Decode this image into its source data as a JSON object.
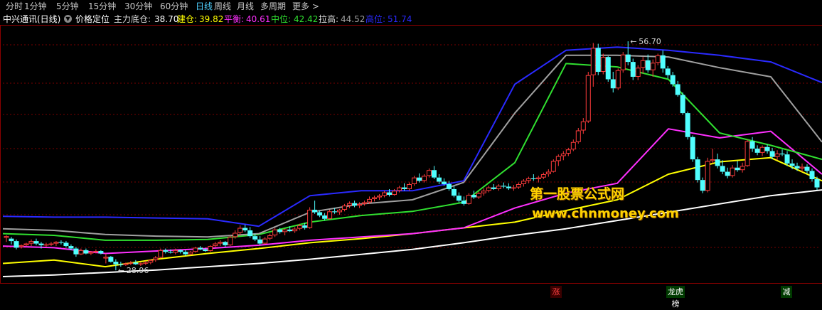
{
  "period_tabs": [
    {
      "label": "分时",
      "active": false
    },
    {
      "label": "1分钟",
      "active": false
    },
    {
      "label": "5分钟",
      "active": false
    },
    {
      "label": "15分钟",
      "active": false
    },
    {
      "label": "30分钟",
      "active": false
    },
    {
      "label": "60分钟",
      "active": false
    },
    {
      "label": "日线",
      "active": true
    },
    {
      "label": "周线",
      "active": false
    },
    {
      "label": "月线",
      "active": false
    },
    {
      "label": "多周期",
      "active": false
    },
    {
      "label": "更多 >",
      "active": false
    }
  ],
  "info": {
    "stock_name": "中兴通讯(日线)",
    "indicator_name": "价格定位",
    "values": [
      {
        "label": "主力底仓:",
        "value": "38.70",
        "color": "#ffffff"
      },
      {
        "label": "建仓:",
        "value": "39.82",
        "color": "#ffff00"
      },
      {
        "label": "平衡:",
        "value": "40.61",
        "color": "#ff30ff"
      },
      {
        "label": "中位:",
        "value": "42.42",
        "color": "#30e030"
      },
      {
        "label": "拉高:",
        "value": "44.52",
        "color": "#a0a0a0"
      },
      {
        "label": "高位:",
        "value": "51.74",
        "color": "#2a2aff"
      }
    ]
  },
  "watermark": {
    "line1": "第一股票公式网",
    "line2": "www.chnmoney.com"
  },
  "markers": [
    {
      "label": "涨",
      "bg": "#3a0000",
      "color": "#ff4040"
    },
    {
      "label": "龙虎榜",
      "bg": "#003a00",
      "color": "#ffffff"
    },
    {
      "label": "减",
      "bg": "#003a00",
      "color": "#ffffff"
    }
  ],
  "colors": {
    "up": "#ff3c3c",
    "down": "#50ffff",
    "grid": "#7a0000",
    "axis": "#8b0000"
  },
  "chart_data": {
    "type": "candlestick",
    "price_range": [
      27.6,
      58.6
    ],
    "annotations": [
      {
        "label": "56.70",
        "price": 56.7,
        "kind": "high"
      },
      {
        "label": "28.96",
        "price": 28.96,
        "kind": "low"
      }
    ],
    "ohlc": [
      [
        32.9,
        33.2,
        32.4,
        33.1
      ],
      [
        32.8,
        33.0,
        32.1,
        32.5
      ],
      [
        32.5,
        32.7,
        31.5,
        31.7
      ],
      [
        31.8,
        32.1,
        31.6,
        32.0
      ],
      [
        32.0,
        32.3,
        31.9,
        32.2
      ],
      [
        32.2,
        32.7,
        31.9,
        32.5
      ],
      [
        32.5,
        32.8,
        32.0,
        32.2
      ],
      [
        32.2,
        32.4,
        31.6,
        32.0
      ],
      [
        32.0,
        32.3,
        31.8,
        32.1
      ],
      [
        32.1,
        32.4,
        31.9,
        32.2
      ],
      [
        32.2,
        32.5,
        31.9,
        32.4
      ],
      [
        32.4,
        32.6,
        32.1,
        32.3
      ],
      [
        32.3,
        32.5,
        31.7,
        31.9
      ],
      [
        31.9,
        32.1,
        31.4,
        31.6
      ],
      [
        31.6,
        31.8,
        30.6,
        30.9
      ],
      [
        30.9,
        31.6,
        30.8,
        31.4
      ],
      [
        31.4,
        31.6,
        30.9,
        31.0
      ],
      [
        31.0,
        31.3,
        30.8,
        31.2
      ],
      [
        31.2,
        31.5,
        31.0,
        31.3
      ],
      [
        31.3,
        31.4,
        30.9,
        31.0
      ],
      [
        30.4,
        31.0,
        29.8,
        30.6
      ],
      [
        30.6,
        30.7,
        29.9,
        30.0
      ],
      [
        30.0,
        30.3,
        28.96,
        29.7
      ],
      [
        29.7,
        30.0,
        29.4,
        29.6
      ],
      [
        29.6,
        29.9,
        29.5,
        29.8
      ],
      [
        29.8,
        30.1,
        29.6,
        29.9
      ],
      [
        29.9,
        30.2,
        29.6,
        29.7
      ],
      [
        29.7,
        29.9,
        29.5,
        29.8
      ],
      [
        29.8,
        30.1,
        29.6,
        29.9
      ],
      [
        29.9,
        30.3,
        29.7,
        30.2
      ],
      [
        30.2,
        30.7,
        30.0,
        30.5
      ],
      [
        30.5,
        31.6,
        30.4,
        31.4
      ],
      [
        31.4,
        31.6,
        31.0,
        31.2
      ],
      [
        31.2,
        31.5,
        31.0,
        31.1
      ],
      [
        31.1,
        31.6,
        30.9,
        31.4
      ],
      [
        31.4,
        31.5,
        31.0,
        31.2
      ],
      [
        31.2,
        31.4,
        30.7,
        30.9
      ],
      [
        30.9,
        31.3,
        30.8,
        31.2
      ],
      [
        31.2,
        31.8,
        31.1,
        31.7
      ],
      [
        31.7,
        31.9,
        31.4,
        31.5
      ],
      [
        31.5,
        31.7,
        31.2,
        31.3
      ],
      [
        31.3,
        32.0,
        31.2,
        31.9
      ],
      [
        31.9,
        32.4,
        31.7,
        32.2
      ],
      [
        32.2,
        32.6,
        31.9,
        32.4
      ],
      [
        32.4,
        32.5,
        31.8,
        32.0
      ],
      [
        32.0,
        33.2,
        31.9,
        33.0
      ],
      [
        33.0,
        33.8,
        32.8,
        33.5
      ],
      [
        33.5,
        34.4,
        33.2,
        34.1
      ],
      [
        34.1,
        34.5,
        33.6,
        33.8
      ],
      [
        33.8,
        34.2,
        32.9,
        33.1
      ],
      [
        33.1,
        33.4,
        32.5,
        32.7
      ],
      [
        32.7,
        33.1,
        32.0,
        32.2
      ],
      [
        32.2,
        33.0,
        32.1,
        32.8
      ],
      [
        32.8,
        33.4,
        32.6,
        33.2
      ],
      [
        33.2,
        34.1,
        33.0,
        33.9
      ],
      [
        33.9,
        34.1,
        33.4,
        33.6
      ],
      [
        33.6,
        34.0,
        33.2,
        33.9
      ],
      [
        33.9,
        34.3,
        33.6,
        33.7
      ],
      [
        33.7,
        34.2,
        33.5,
        34.0
      ],
      [
        34.0,
        34.6,
        33.8,
        34.4
      ],
      [
        34.4,
        34.7,
        33.9,
        34.1
      ],
      [
        34.1,
        36.6,
        34.0,
        36.3
      ],
      [
        36.3,
        37.4,
        35.8,
        36.0
      ],
      [
        36.0,
        36.2,
        35.4,
        35.6
      ],
      [
        35.6,
        35.9,
        35.0,
        35.2
      ],
      [
        35.2,
        36.3,
        35.1,
        36.1
      ],
      [
        36.1,
        36.5,
        35.8,
        36.0
      ],
      [
        36.0,
        36.4,
        35.7,
        36.3
      ],
      [
        36.3,
        37.0,
        36.1,
        36.8
      ],
      [
        36.8,
        37.3,
        36.5,
        37.1
      ],
      [
        37.1,
        37.4,
        36.6,
        36.8
      ],
      [
        36.8,
        37.2,
        36.5,
        37.0
      ],
      [
        37.0,
        37.4,
        36.8,
        37.2
      ],
      [
        37.2,
        37.9,
        37.0,
        37.6
      ],
      [
        37.6,
        38.0,
        37.3,
        37.8
      ],
      [
        37.8,
        38.2,
        37.5,
        38.0
      ],
      [
        38.0,
        38.6,
        37.8,
        38.4
      ],
      [
        38.4,
        38.8,
        37.9,
        38.1
      ],
      [
        38.1,
        38.8,
        38.0,
        38.6
      ],
      [
        38.6,
        39.2,
        38.4,
        39.0
      ],
      [
        39.0,
        39.5,
        38.6,
        38.8
      ],
      [
        38.8,
        39.6,
        38.6,
        39.4
      ],
      [
        39.4,
        40.4,
        39.2,
        40.2
      ],
      [
        40.2,
        40.7,
        39.6,
        39.8
      ],
      [
        39.8,
        40.6,
        39.6,
        40.4
      ],
      [
        40.4,
        41.3,
        40.2,
        41.1
      ],
      [
        41.1,
        41.6,
        40.0,
        40.2
      ],
      [
        40.2,
        40.6,
        39.4,
        39.7
      ],
      [
        39.7,
        40.1,
        39.2,
        39.4
      ],
      [
        39.4,
        39.8,
        38.6,
        38.8
      ],
      [
        38.8,
        39.2,
        37.8,
        38.0
      ],
      [
        38.0,
        38.4,
        37.2,
        37.4
      ],
      [
        37.4,
        37.9,
        36.8,
        37.0
      ],
      [
        37.0,
        38.3,
        36.9,
        38.1
      ],
      [
        38.1,
        38.6,
        37.6,
        37.8
      ],
      [
        37.8,
        38.5,
        37.6,
        38.3
      ],
      [
        38.3,
        38.9,
        38.0,
        38.6
      ],
      [
        38.6,
        39.2,
        38.4,
        39.0
      ],
      [
        39.0,
        39.4,
        38.7,
        38.8
      ],
      [
        38.8,
        39.4,
        38.6,
        39.2
      ],
      [
        39.2,
        39.6,
        38.9,
        39.1
      ],
      [
        39.1,
        39.5,
        38.7,
        38.9
      ],
      [
        38.9,
        39.3,
        38.6,
        39.0
      ],
      [
        39.0,
        39.6,
        38.8,
        39.4
      ],
      [
        39.4,
        40.0,
        39.1,
        39.8
      ],
      [
        39.8,
        40.3,
        39.5,
        40.1
      ],
      [
        40.1,
        40.6,
        39.8,
        40.0
      ],
      [
        40.0,
        40.4,
        39.6,
        40.2
      ],
      [
        40.2,
        40.8,
        40.0,
        40.6
      ],
      [
        40.6,
        41.2,
        40.3,
        40.9
      ],
      [
        40.9,
        42.4,
        40.8,
        42.2
      ],
      [
        42.2,
        43.0,
        41.6,
        42.8
      ],
      [
        42.8,
        43.4,
        42.3,
        43.1
      ],
      [
        43.1,
        43.8,
        42.8,
        43.6
      ],
      [
        43.6,
        44.8,
        43.4,
        44.5
      ],
      [
        44.5,
        46.2,
        44.3,
        45.9
      ],
      [
        45.9,
        47.4,
        45.5,
        47.0
      ],
      [
        47.0,
        53.0,
        46.8,
        52.6
      ],
      [
        52.6,
        56.5,
        51.2,
        55.9
      ],
      [
        55.9,
        56.4,
        52.6,
        53.0
      ],
      [
        53.0,
        55.2,
        52.7,
        54.8
      ],
      [
        54.8,
        54.9,
        51.8,
        52.1
      ],
      [
        52.1,
        53.0,
        50.5,
        51.0
      ],
      [
        51.0,
        53.4,
        50.8,
        53.2
      ],
      [
        53.2,
        55.4,
        52.9,
        55.1
      ],
      [
        55.1,
        56.7,
        53.8,
        54.2
      ],
      [
        54.2,
        54.6,
        52.0,
        52.4
      ],
      [
        52.4,
        53.8,
        52.0,
        53.5
      ],
      [
        53.5,
        54.8,
        52.8,
        54.4
      ],
      [
        54.4,
        55.1,
        52.9,
        53.2
      ],
      [
        53.2,
        54.5,
        52.4,
        54.1
      ],
      [
        54.1,
        55.2,
        53.8,
        55.0
      ],
      [
        55.0,
        55.6,
        52.9,
        53.4
      ],
      [
        53.4,
        53.7,
        52.2,
        52.6
      ],
      [
        52.6,
        53.0,
        51.2,
        51.5
      ],
      [
        51.5,
        51.9,
        50.0,
        50.2
      ],
      [
        50.2,
        50.5,
        47.8,
        48.0
      ],
      [
        48.0,
        48.2,
        44.8,
        45.1
      ],
      [
        45.1,
        45.3,
        42.1,
        42.4
      ],
      [
        42.4,
        42.7,
        39.6,
        39.9
      ],
      [
        39.9,
        40.2,
        38.3,
        38.6
      ],
      [
        38.6,
        42.6,
        38.4,
        42.2
      ],
      [
        42.2,
        43.7,
        41.9,
        42.4
      ],
      [
        42.4,
        43.1,
        41.3,
        41.6
      ],
      [
        41.6,
        42.3,
        40.6,
        40.9
      ],
      [
        40.9,
        41.4,
        40.1,
        40.4
      ],
      [
        40.4,
        41.7,
        40.2,
        41.4
      ],
      [
        41.4,
        42.2,
        40.9,
        41.1
      ],
      [
        41.1,
        42.0,
        40.8,
        41.6
      ],
      [
        41.6,
        44.8,
        41.5,
        44.6
      ],
      [
        44.6,
        45.1,
        43.3,
        43.7
      ],
      [
        43.7,
        44.1,
        42.9,
        43.2
      ],
      [
        43.2,
        44.1,
        42.8,
        43.9
      ],
      [
        43.9,
        44.2,
        43.1,
        43.4
      ],
      [
        43.4,
        43.8,
        42.4,
        42.7
      ],
      [
        42.7,
        43.5,
        42.3,
        43.1
      ],
      [
        43.1,
        43.6,
        42.8,
        43.0
      ],
      [
        43.0,
        43.4,
        41.6,
        41.9
      ],
      [
        41.9,
        42.4,
        41.2,
        41.6
      ],
      [
        41.6,
        42.0,
        41.0,
        41.3
      ],
      [
        41.3,
        41.9,
        40.9,
        41.5
      ],
      [
        41.5,
        41.8,
        40.7,
        41.0
      ],
      [
        41.0,
        41.3,
        39.7,
        40.0
      ],
      [
        40.0,
        40.3,
        38.7,
        39.0
      ]
    ],
    "series": [
      {
        "name": "主力底仓",
        "color": "#ffffff",
        "values": [
          28.2,
          28.4,
          28.7,
          29.0,
          29.4,
          29.8,
          30.3,
          30.9,
          31.5,
          32.3,
          33.2,
          34.0,
          35.0,
          36.0,
          37.0,
          38.0,
          38.7
        ]
      },
      {
        "name": "建仓",
        "color": "#ffff00",
        "values": [
          29.8,
          30.2,
          29.4,
          30.3,
          31.0,
          31.6,
          32.3,
          32.8,
          33.4,
          34.1,
          34.8,
          36.2,
          37.5,
          40.6,
          42.1,
          42.6,
          39.8
        ]
      },
      {
        "name": "平衡",
        "color": "#ff30ff",
        "values": [
          31.9,
          31.7,
          31.0,
          31.3,
          31.6,
          32.0,
          32.6,
          33.0,
          33.4,
          34.1,
          36.5,
          38.3,
          39.5,
          46.1,
          45.0,
          45.8,
          40.6
        ]
      },
      {
        "name": "中位",
        "color": "#30e030",
        "values": [
          33.4,
          33.2,
          32.6,
          32.6,
          32.7,
          33.3,
          34.8,
          35.6,
          36.1,
          37.2,
          42.0,
          54.0,
          53.6,
          52.1,
          45.6,
          44.1,
          42.4
        ]
      },
      {
        "name": "拉高",
        "color": "#a0a0a0",
        "values": [
          34.0,
          33.8,
          33.3,
          33.1,
          33.0,
          33.4,
          36.0,
          37.0,
          37.5,
          39.6,
          48.0,
          55.0,
          55.0,
          54.8,
          53.5,
          52.4,
          44.5
        ]
      },
      {
        "name": "高位",
        "color": "#2a2aff",
        "values": [
          35.5,
          35.4,
          35.4,
          35.3,
          35.2,
          34.3,
          38.0,
          38.6,
          38.6,
          39.8,
          51.5,
          55.6,
          56.0,
          55.6,
          55.0,
          54.2,
          51.7
        ]
      }
    ]
  }
}
